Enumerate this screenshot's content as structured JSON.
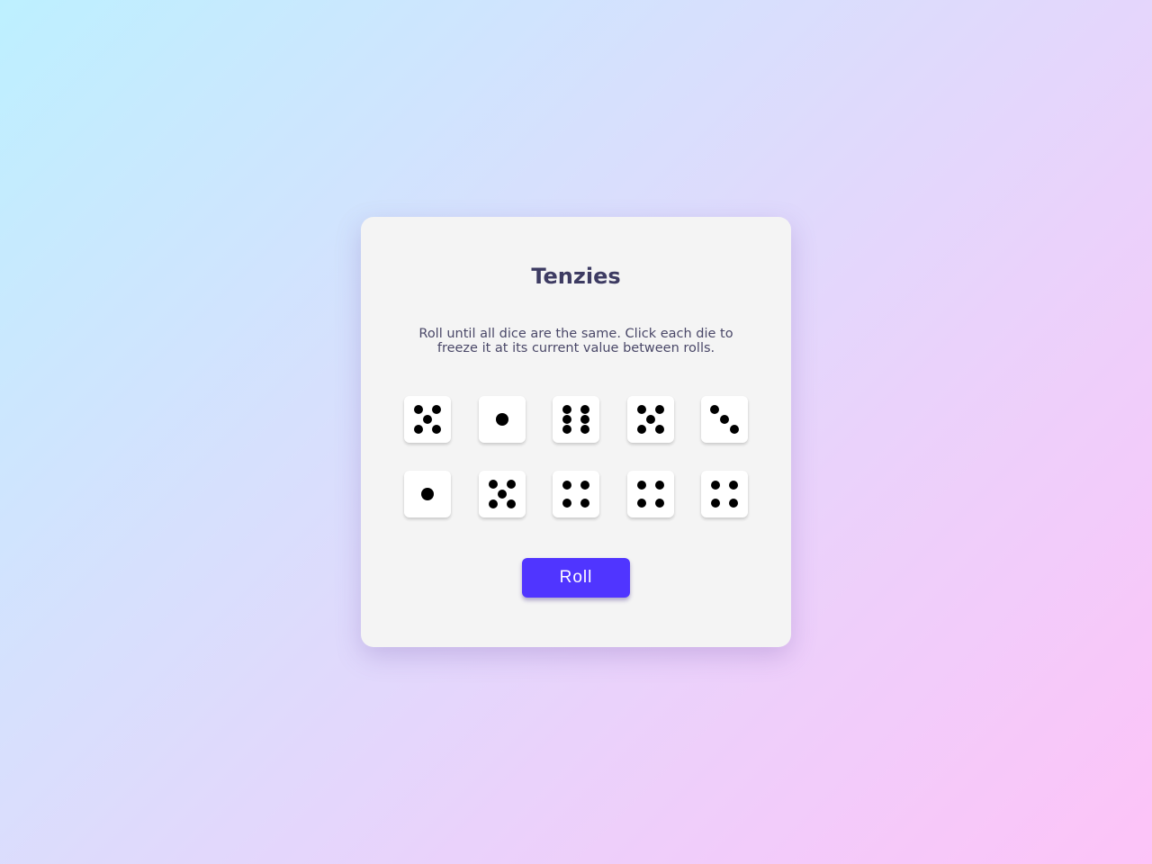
{
  "game": {
    "title": "Tenzies",
    "instructions": "Roll until all dice are the same. Click each die to freeze it at its current value between rolls.",
    "roll_label": "Roll",
    "dice": [
      {
        "value": 5,
        "held": false
      },
      {
        "value": 1,
        "held": false
      },
      {
        "value": 6,
        "held": false
      },
      {
        "value": 5,
        "held": false
      },
      {
        "value": 3,
        "held": false
      },
      {
        "value": 1,
        "held": false
      },
      {
        "value": 5,
        "held": false
      },
      {
        "value": 4,
        "held": false
      },
      {
        "value": 4,
        "held": false
      },
      {
        "value": 4,
        "held": false
      }
    ]
  },
  "colors": {
    "card_background": "#f4f4f4",
    "die_background": "#ffffff",
    "pip": "#000000",
    "button": "#5035ff",
    "title_text": "#3d3b62"
  }
}
